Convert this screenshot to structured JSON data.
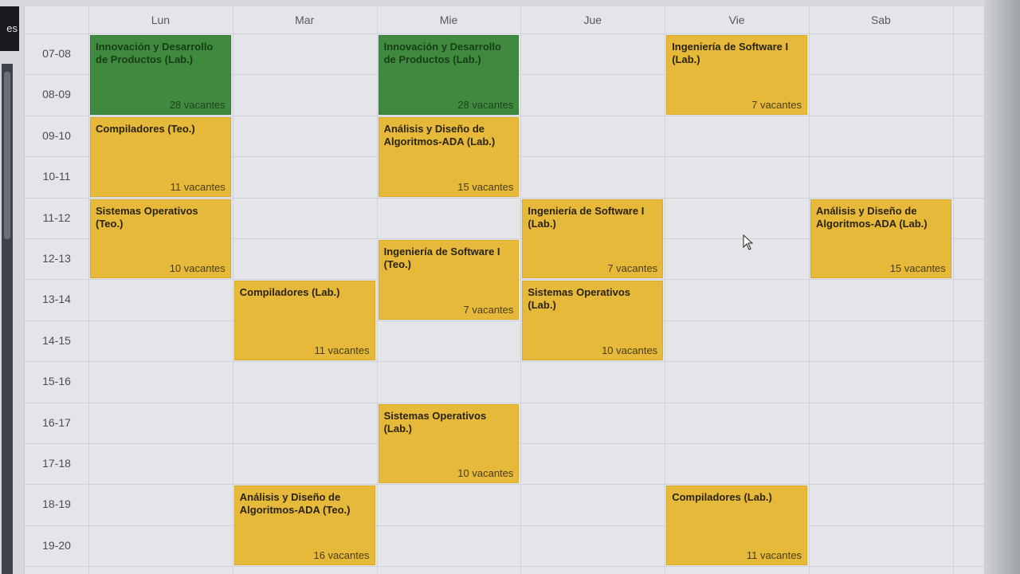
{
  "window": {
    "side_tab_text": "es"
  },
  "calendar": {
    "days": [
      "Lun",
      "Mar",
      "Mie",
      "Jue",
      "Vie",
      "Sab"
    ],
    "hours": [
      "07-08",
      "08-09",
      "09-10",
      "10-11",
      "11-12",
      "12-13",
      "13-14",
      "14-15",
      "15-16",
      "16-17",
      "17-18",
      "18-19",
      "19-20"
    ],
    "colors": {
      "lab_green": "#3f8a3e",
      "course_yellow": "#e6b93a"
    },
    "events": [
      {
        "day": 0,
        "start": 0,
        "span": 2,
        "color": "green",
        "title": "Innovación y Desarrollo de Productos (Lab.)",
        "vacancies": "28 vacantes"
      },
      {
        "day": 2,
        "start": 0,
        "span": 2,
        "color": "green",
        "title": "Innovación y Desarrollo de Productos (Lab.)",
        "vacancies": "28 vacantes"
      },
      {
        "day": 4,
        "start": 0,
        "span": 2,
        "color": "yellow",
        "title": "Ingeniería de Software I (Lab.)",
        "vacancies": "7 vacantes"
      },
      {
        "day": 0,
        "start": 2,
        "span": 2,
        "color": "yellow",
        "title": "Compiladores (Teo.)",
        "vacancies": "11 vacantes"
      },
      {
        "day": 2,
        "start": 2,
        "span": 2,
        "color": "yellow",
        "title": "Análisis y Diseño de Algoritmos-ADA (Lab.)",
        "vacancies": "15 vacantes"
      },
      {
        "day": 0,
        "start": 4,
        "span": 2,
        "color": "yellow",
        "title": "Sistemas Operativos (Teo.)",
        "vacancies": "10 vacantes"
      },
      {
        "day": 3,
        "start": 4,
        "span": 2,
        "color": "yellow",
        "title": "Ingeniería de Software I (Lab.)",
        "vacancies": "7 vacantes"
      },
      {
        "day": 5,
        "start": 4,
        "span": 2,
        "color": "yellow",
        "title": "Análisis y Diseño de Algoritmos-ADA (Lab.)",
        "vacancies": "15 vacantes"
      },
      {
        "day": 2,
        "start": 5,
        "span": 2,
        "color": "yellow",
        "title": "Ingeniería de Software I (Teo.)",
        "vacancies": "7 vacantes"
      },
      {
        "day": 1,
        "start": 6,
        "span": 2,
        "color": "yellow",
        "title": "Compiladores (Lab.)",
        "vacancies": "11 vacantes"
      },
      {
        "day": 3,
        "start": 6,
        "span": 2,
        "color": "yellow",
        "title": "Sistemas Operativos (Lab.)",
        "vacancies": "10 vacantes"
      },
      {
        "day": 2,
        "start": 9,
        "span": 2,
        "color": "yellow",
        "title": "Sistemas Operativos (Lab.)",
        "vacancies": "10 vacantes"
      },
      {
        "day": 1,
        "start": 11,
        "span": 2,
        "color": "yellow",
        "title": "Análisis y Diseño de Algoritmos-ADA (Teo.)",
        "vacancies": "16 vacantes"
      },
      {
        "day": 4,
        "start": 11,
        "span": 2,
        "color": "yellow",
        "title": "Compiladores (Lab.)",
        "vacancies": "11 vacantes"
      }
    ]
  }
}
